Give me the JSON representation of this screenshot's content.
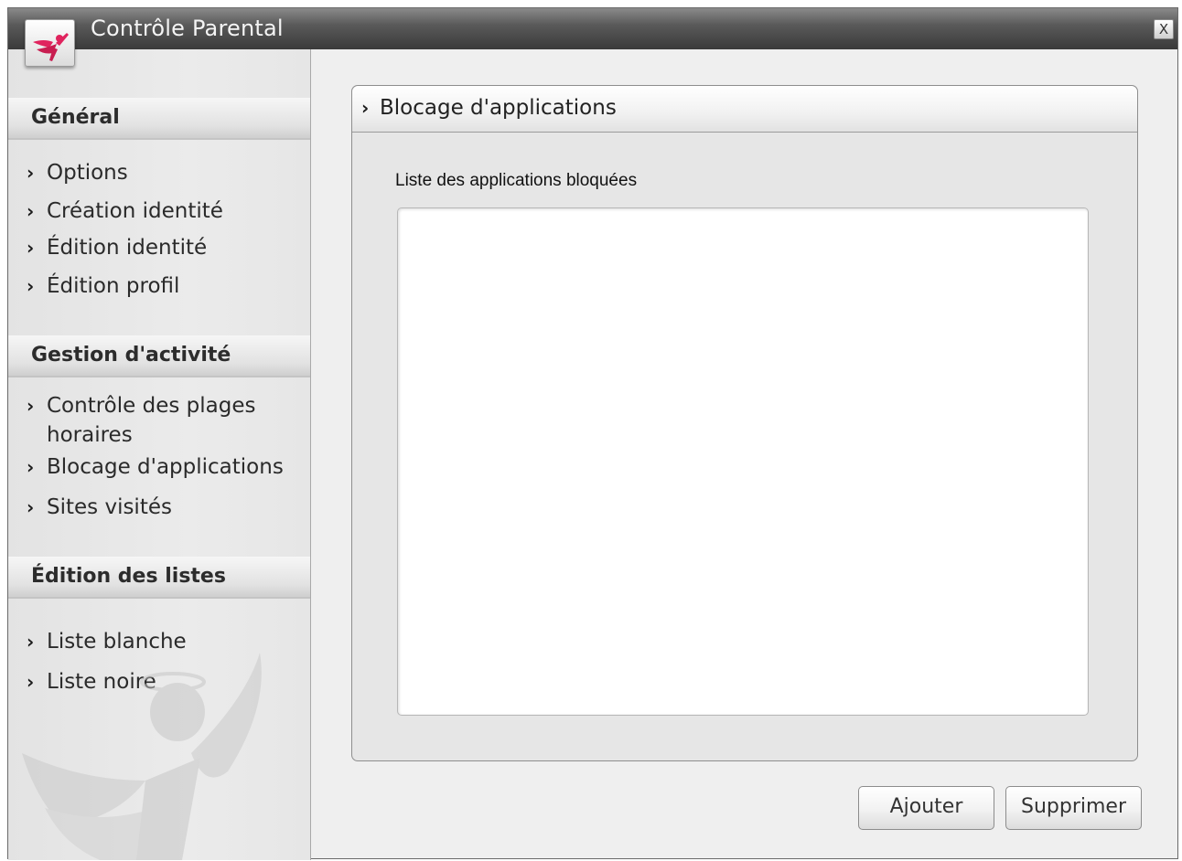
{
  "window": {
    "title": "Contrôle Parental",
    "close_label": "X"
  },
  "sidebar": {
    "sections": [
      {
        "header": "Général",
        "items": [
          {
            "label": "Options"
          },
          {
            "label": "Création identité"
          },
          {
            "label": "Édition identité"
          },
          {
            "label": "Édition profil"
          }
        ]
      },
      {
        "header": "Gestion d'activité",
        "items": [
          {
            "label": "Contrôle des plages horaires"
          },
          {
            "label": "Blocage d'applications"
          },
          {
            "label": "Sites visités"
          }
        ]
      },
      {
        "header": "Édition des listes",
        "items": [
          {
            "label": "Liste blanche"
          },
          {
            "label": "Liste noire"
          }
        ]
      }
    ]
  },
  "main": {
    "panel_title": "Blocage d'applications",
    "list_label": "Liste des applications bloquées",
    "list_items": []
  },
  "buttons": {
    "add": "Ajouter",
    "remove": "Supprimer"
  },
  "colors": {
    "titlebar": "#4a4a4a",
    "logo_accent": "#e0245e"
  },
  "icons": {
    "chevron": "chevron-right-icon",
    "logo": "parental-control-logo-icon",
    "close": "close-icon"
  }
}
